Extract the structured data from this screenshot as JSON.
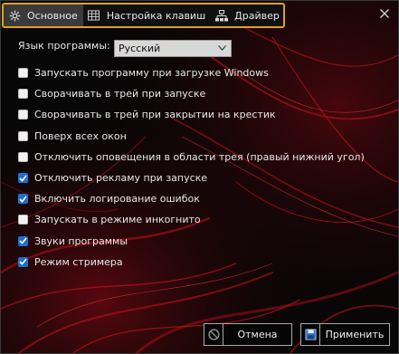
{
  "tabs": [
    {
      "label": "Основное",
      "icon": "gear-icon",
      "active": true
    },
    {
      "label": "Настройка клавиш",
      "icon": "keyboard-icon",
      "active": false
    },
    {
      "label": "Драйвер",
      "icon": "network-icon",
      "active": false
    }
  ],
  "close_icon": "close-icon",
  "language": {
    "label": "Язык программы:",
    "value": "Русский"
  },
  "options": [
    {
      "label": "Запускать программу при загрузке Windows",
      "checked": false
    },
    {
      "label": "Сворачивать в трей при запуске",
      "checked": false
    },
    {
      "label": "Сворачивать в трей при закрытии на крестик",
      "checked": false
    },
    {
      "label": "Поверх всех окон",
      "checked": false
    },
    {
      "label": "Отключить оповещения в области трея (правый нижний угол)",
      "checked": false
    },
    {
      "label": "Отключить рекламу при запуске",
      "checked": true
    },
    {
      "label": "Включить логирование ошибок",
      "checked": true
    },
    {
      "label": "Запускать в режиме инкогнито",
      "checked": false
    },
    {
      "label": "Звуки программы",
      "checked": true
    },
    {
      "label": "Режим стримера",
      "checked": true
    }
  ],
  "buttons": {
    "cancel": "Отмена",
    "apply": "Применить"
  },
  "colors": {
    "tab_highlight": "#e0a21a",
    "checkbox_checked": "#1f6fd1",
    "background_art": "#c0101a"
  }
}
